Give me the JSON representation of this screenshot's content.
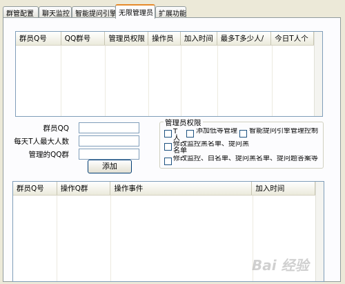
{
  "tabs": [
    {
      "label": "群管配置"
    },
    {
      "label": "聊天监控"
    },
    {
      "label": "智能提问引擎"
    },
    {
      "label": "无限管理员"
    },
    {
      "label": "扩展功能"
    }
  ],
  "admin_list": {
    "columns": [
      "群员Q号",
      "QQ群号",
      "管理员权限",
      "操作员",
      "加入时间",
      "最多T多少人/",
      "今日T人个"
    ]
  },
  "form": {
    "member_qq_label": "群员QQ",
    "daily_kick_label": "每天T人最大人数",
    "managed_group_label": "管理的QQ群",
    "add_button": "添加"
  },
  "permissions": {
    "title": "管理员权限",
    "options": [
      {
        "label": "T人"
      },
      {
        "label": "添加低等管理"
      },
      {
        "label": "智能提问引擎管理控制"
      },
      {
        "label": "修改监控黑名单、提问黑名单"
      },
      {
        "label": "修改监控、白名单、提问黑名单、提问题答案等"
      }
    ]
  },
  "log_list": {
    "columns": [
      "群员Q号",
      "操作Q群",
      "操作事件",
      "加入时间"
    ]
  },
  "watermark": {
    "text": "Bai 经验"
  }
}
